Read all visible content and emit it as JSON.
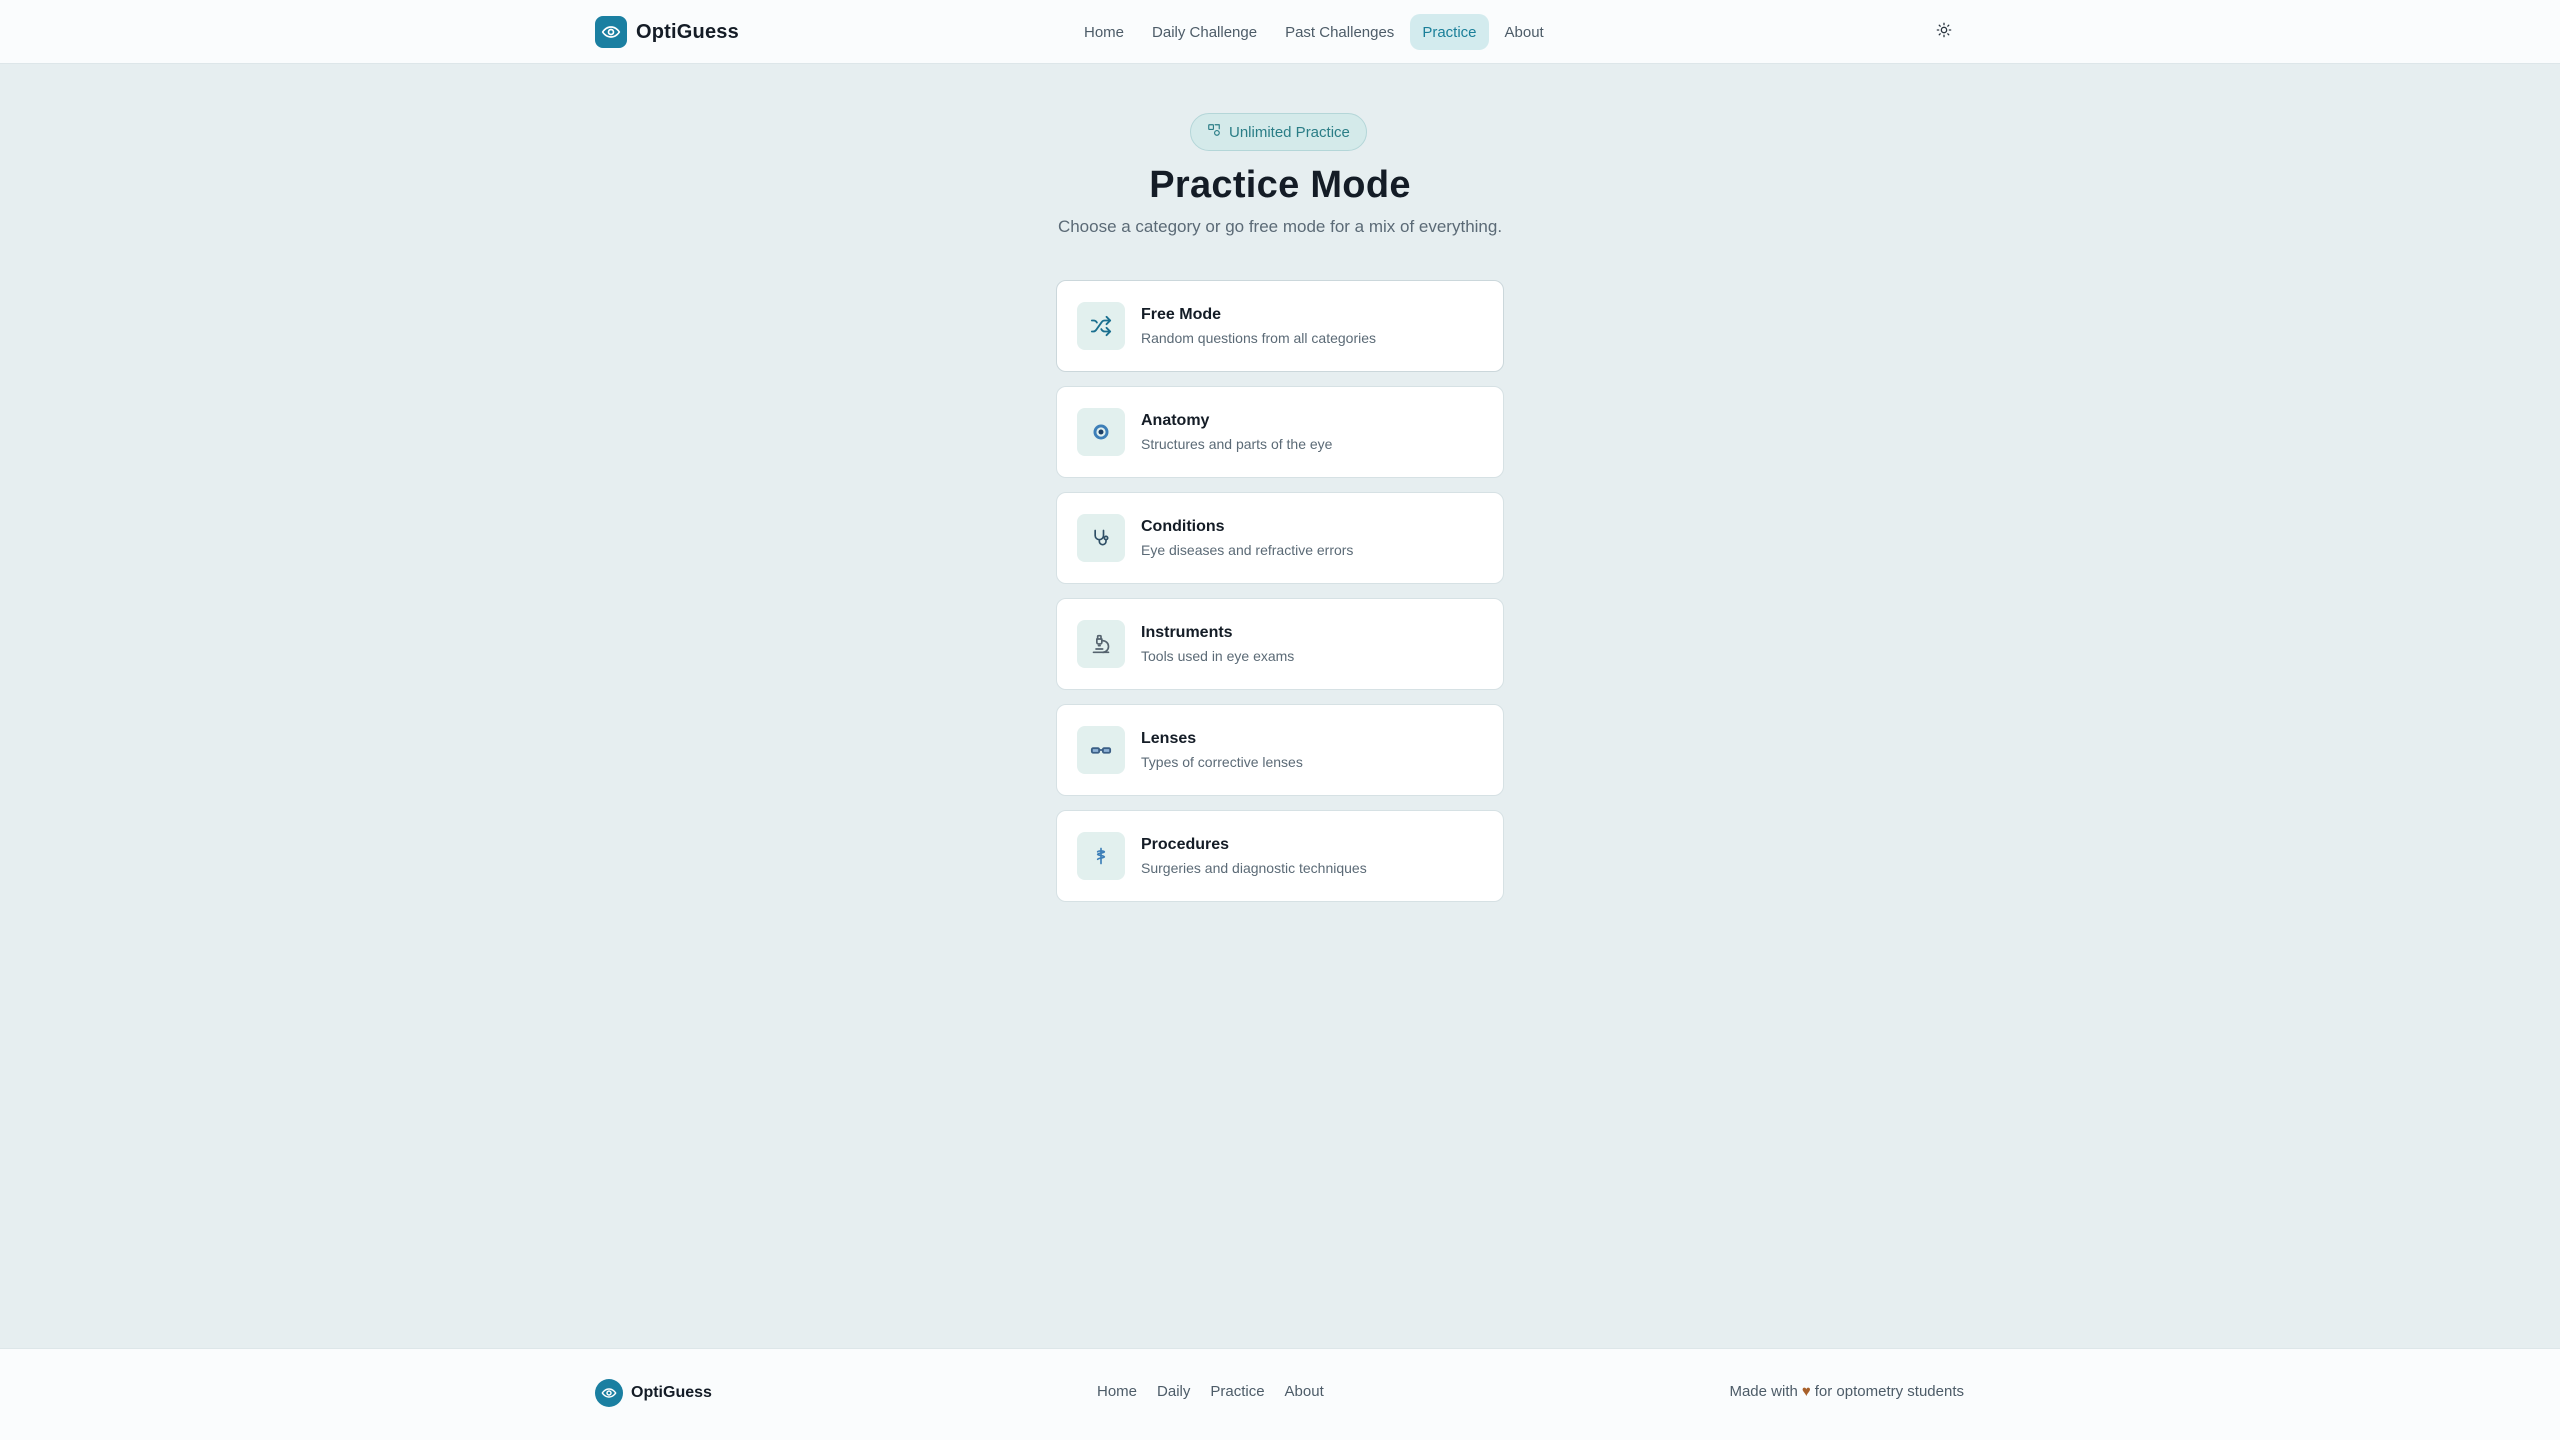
{
  "header": {
    "brand": "OptiGuess",
    "nav": [
      "Home",
      "Daily Challenge",
      "Past Challenges",
      "Practice",
      "About"
    ],
    "active_nav": "Practice"
  },
  "main": {
    "badge": "Unlimited Practice",
    "title": "Practice Mode",
    "subtitle": "Choose a category or go free mode for a mix of everything.",
    "cards": [
      {
        "title": "Free Mode",
        "desc": "Random questions from all categories",
        "icon": "shuffle-icon"
      },
      {
        "title": "Anatomy",
        "desc": "Structures and parts of the eye",
        "icon": "eye-target-icon"
      },
      {
        "title": "Conditions",
        "desc": "Eye diseases and refractive errors",
        "icon": "stethoscope-icon"
      },
      {
        "title": "Instruments",
        "desc": "Tools used in eye exams",
        "icon": "microscope-icon"
      },
      {
        "title": "Lenses",
        "desc": "Types of corrective lenses",
        "icon": "glasses-icon"
      },
      {
        "title": "Procedures",
        "desc": "Surgeries and diagnostic techniques",
        "icon": "caduceus-icon"
      }
    ]
  },
  "footer": {
    "brand": "OptiGuess",
    "links": [
      "Home",
      "Daily",
      "Practice",
      "About"
    ],
    "made_prefix": "Made with",
    "made_suffix": "for optometry students",
    "heart_icon": "heart-icon"
  },
  "colors": {
    "accent": "#1a7fa1",
    "background": "#e6eef0",
    "active_nav_bg": "#d3ebee",
    "heart": "#a8602a"
  }
}
